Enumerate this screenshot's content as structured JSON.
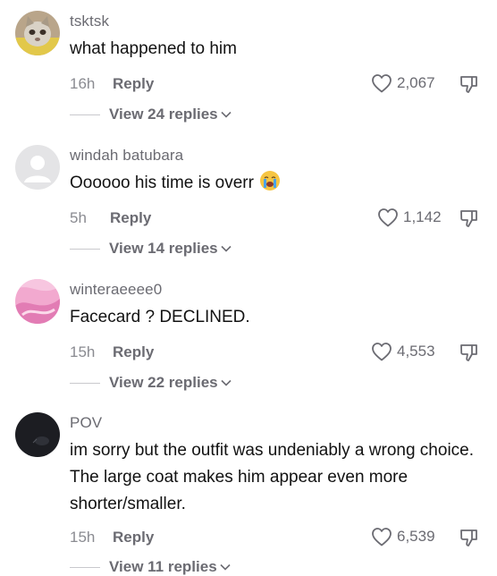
{
  "comments": [
    {
      "username": "tsktsk",
      "text": "what happened to him",
      "time": "16h",
      "reply_label": "Reply",
      "likes": "2,067",
      "view_replies": "View 24 replies",
      "avatar_icon": "cat-avatar"
    },
    {
      "username": "windah batubara",
      "text": "Oooooo his time is overr",
      "emoji": "crying-face-icon",
      "time": "5h",
      "reply_label": "Reply",
      "likes": "1,142",
      "view_replies": "View 14 replies",
      "avatar_icon": "default-avatar"
    },
    {
      "username": "winteraeeee0",
      "text": "Facecard ? DECLINED.",
      "time": "15h",
      "reply_label": "Reply",
      "likes": "4,553",
      "view_replies": "View 22 replies",
      "avatar_icon": "pink-avatar"
    },
    {
      "username": "POV",
      "text": "im sorry but the outfit was undeniably a wrong choice. The large coat makes him appear even more shorter/smaller.",
      "time": "15h",
      "reply_label": "Reply",
      "likes": "6,539",
      "view_replies": "View 11 replies",
      "avatar_icon": "dark-avatar"
    }
  ],
  "colors": {
    "text": "#121212",
    "muted": "#6b6b72",
    "time": "#8a8b91",
    "divider": "#c9c9cd"
  }
}
